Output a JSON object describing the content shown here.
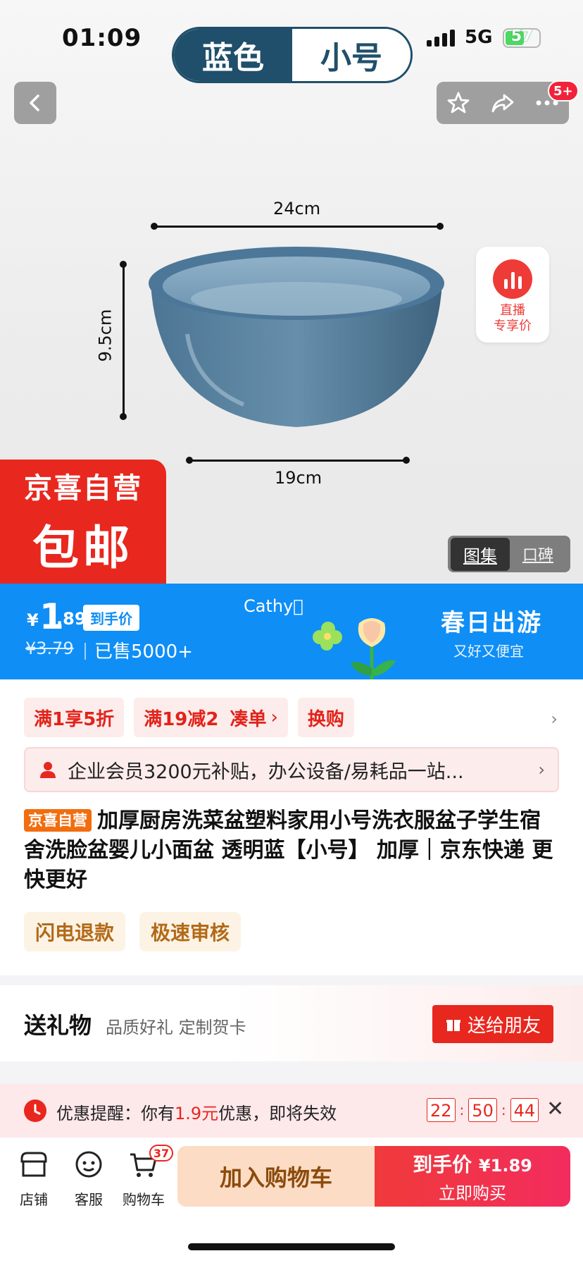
{
  "status": {
    "time": "01:09",
    "network": "5G",
    "battery": "57"
  },
  "variant": {
    "color": "蓝色",
    "size": "小号"
  },
  "top_actions": {
    "badge": "5+"
  },
  "hero": {
    "dim_top": "24cm",
    "dim_side": "9.5cm",
    "dim_bottom": "19cm",
    "live_line1": "直播",
    "live_line2": "专享价",
    "promo_line1": "京喜自营",
    "promo_line2": "包邮",
    "gallery": "图集",
    "reviews": "口碑"
  },
  "price": {
    "symbol": "¥",
    "main": "1",
    "decimals": ".89",
    "tag": "到手价",
    "original": "¥3.79",
    "sold": "已售5000+",
    "cathy": "Cathy\u0000",
    "spring_title": "春日出游",
    "spring_sub": "又好又便宜"
  },
  "coupons": [
    {
      "label": "满1享5折"
    },
    {
      "label": "满19减2",
      "extra": "凑单"
    },
    {
      "label": "换购"
    }
  ],
  "member": {
    "text": "企业会员3200元补贴，办公设备/易耗品一站..."
  },
  "product": {
    "tag": "京喜自营",
    "title": "加厚厨房洗菜盆塑料家用小号洗衣服盆子学生宿舍洗脸盆婴儿小面盆 透明蓝【小号】 加厚｜京东快递 更快更好"
  },
  "services": [
    "闪电退款",
    "极速审核"
  ],
  "gift": {
    "title": "送礼物",
    "sub": "品质好礼 定制贺卡",
    "button": "送给朋友"
  },
  "reminder": {
    "prefix": "优惠提醒：你有",
    "amount": "1.9元",
    "suffix": "优惠，即将失效",
    "hh": "22",
    "mm": "50",
    "ss": "44"
  },
  "bottom": {
    "store": "店铺",
    "service": "客服",
    "cart": "购物车",
    "cart_count": "37",
    "add_cart": "加入购物车",
    "buy_line1": "到手价",
    "buy_price": "¥1.89",
    "buy_line2": "立即购买"
  },
  "colors": {
    "brand_red": "#e8271e",
    "price_blue": "#0f8ef6",
    "variant_navy": "#1f4f6b"
  }
}
